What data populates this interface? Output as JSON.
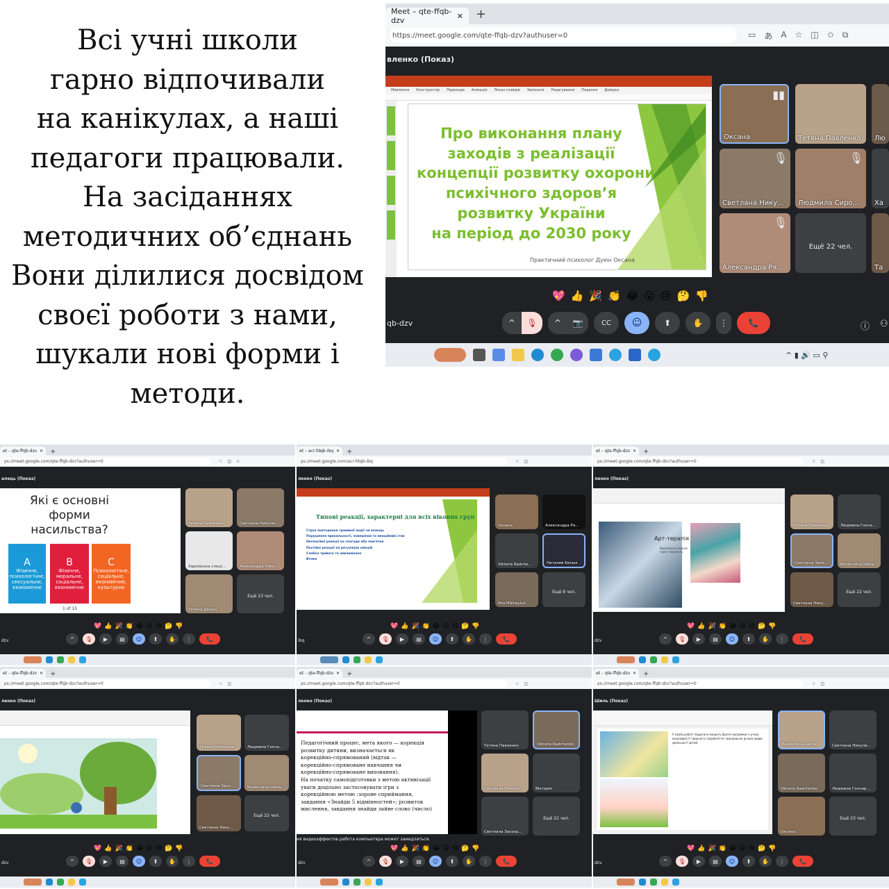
{
  "caption": {
    "lines": [
      "Всі учні школи",
      "гарно відпочивали",
      "на канікулах, а наші",
      "педагоги працювали.",
      "На засіданнях",
      "методичних об’єднань",
      "Вони ділилися досвідом",
      "своєї роботи з нами,",
      "шукали нові форми і",
      "методи."
    ]
  },
  "big": {
    "tab_title": "Meet – qte-ffqb-dzv",
    "new_tab": "+",
    "url": "https://meet.google.com/qte-ffqb-dzv?authuser=0",
    "presenter": "вленко (Показ)",
    "meeting_code": "qb-dzv",
    "ppt_menu": [
      "Мовлення",
      "Конструктор",
      "Переходи",
      "Анімація",
      "Показ слайдів",
      "Записати",
      "Редагування",
      "Подання",
      "Довідка"
    ],
    "slide_title": [
      "Про виконання плану",
      "заходів з реалізації",
      "концепції розвитку охорони",
      "психічного здоров’я",
      "розвитку України",
      "на період до 2030 року"
    ],
    "slide_author": "Практичний психолог Дуюн Оксана",
    "tiles": [
      "Оксана",
      "Тетяна Павленко",
      "Лю",
      "Светлана Нику...",
      "Людмила Сиро...",
      "Ха",
      "Александра Ря...",
      "Ещё 22 чел.",
      "Та"
    ],
    "reactions": [
      "💖",
      "👍",
      "🎉",
      "👏",
      "😂",
      "😮",
      "😢",
      "🤔",
      "👎"
    ]
  },
  "shots": [
    {
      "tab_title": "et – qte-ffqb-dzv",
      "url": "ps://meet.google.com/qte-ffqb-dzv?authuser=0",
      "presenter": "алець (Показ)",
      "code": "dzv",
      "slide_question": [
        "Які є основні",
        "форми",
        "насильства?"
      ],
      "boxes": [
        {
          "letter": "A",
          "text": "Фізичне, психологічне, сексуальне, економічне"
        },
        {
          "letter": "B",
          "text": "Фізичне, моральне, соціальне, економічне"
        },
        {
          "letter": "C",
          "text": "Психологічне, соціальне, економічне, культурне"
        }
      ],
      "pager": "1 of 15",
      "tiles": [
        "Тетяна Павленко",
        "Светлана Никули...",
        "Харківська спеці...",
        "Александра Рябк...",
        "Тетяна Дашко",
        "Ещё 23 чел."
      ]
    },
    {
      "tab_title": "et – acr-fdqb-ibq",
      "url": "ps://meet.google.com/acr-fdqb-ibq",
      "presenter": "ленко (Показ)",
      "code": "ibq",
      "slide_heading": "Типові реакції, характерні для всіх вікових груп",
      "bullets": [
        "Страх повторення травмної події чи вожаць",
        "Порушення прихильності, поведінки та емоційний стан",
        "Неспокійні реакції на спогади або пам'ятки",
        "Постійні реакції на регуляцію емоцій",
        "Слабка тривога та хвилювання",
        "Втома"
      ],
      "tiles": [
        "Оксана",
        "Александра Ря...",
        "Viktoria Radche...",
        "Наталия Белых",
        "Alla Mikhayluk",
        "Ещё 8 чел."
      ]
    },
    {
      "tab_title": "et – qte-ffqb-dzv",
      "url": "ps://meet.google.com/qte-ffqb-dzv?authuser=0",
      "presenter": "ленко (Показ)",
      "code": "dzv",
      "slide_heading": "Арт-терапія",
      "slide_note": "Вираження емоцій через творчість",
      "tiles": [
        "Тетяна Павленко",
        "Людмила Гонча...",
        "Светлана Засе...",
        "Валентина Шиль",
        "Светлана Нику...",
        "Ещё 22 чел."
      ]
    },
    {
      "tab_title": "et – qte-ffqb-dzv",
      "url": "ps://meet.google.com/qte-ffqb-dzv?authuser=0",
      "presenter": "ленко (Показ)",
      "code": "dzv",
      "tiles": [
        "Тетяна Павленко",
        "Людмила Гонча...",
        "Светлана Засе...",
        "Валентина Шиль",
        "Светлана Нику...",
        "Ещё 22 чел."
      ]
    },
    {
      "tab_title": "et – qte-ffqb-dzv",
      "url": "ps://meet.google.com/qte-ffqb-dzv?authuser=0",
      "presenter": "ленко (Показ)",
      "code": "dzv",
      "slide_text": [
        "Педагогічний процес, мета якого — корекція",
        "розвитку дитини, визначається як",
        "корекційно-спрямований (відтак —",
        "корекційно-спрямоване навчання чи",
        "корекційно-спрямоване виховання).",
        "На початку самопідготовки з метою активізації",
        "уваги доцільно застосовувати ігри з",
        "корекційною метою :зорове сприймання,",
        "завдання «Знайди 5 відмінностей»; розвиток",
        "мислення, завдання знайди зайве слово (число)"
      ],
      "warning": "ия видеоэффектов работа компьютера может замедлиться.",
      "tiles": [
        "Тетяна Павленко",
        "Viktoria Radchenko",
        "Светлана Никули...",
        "Вікторія",
        "Светлана Засоэр...",
        "Ещё 22 чел."
      ]
    },
    {
      "tab_title": "et – qte-ffqb-dzv",
      "url": "ps://meet.google.com/qte-ffqb-dzv?authuser=0",
      "presenter": "Шиль (Показ)",
      "code": "dzv",
      "slide_par": "У своїй роботі педагоги можуть брати напрямки з учнів, можливості творчого сприйняття і виховання різних видів діяльності дітей.",
      "tiles": [
        "Валентина Шиль",
        "Светлана Никули...",
        "Viktoria Radchenko",
        "Людмила Гончар...",
        "Оксана",
        "Ещё 23 чел."
      ]
    }
  ],
  "controls": [
    "^",
    "🎙",
    "^",
    "📷",
    "CC",
    "☺",
    "⬆",
    "✋",
    "⋮",
    "📞"
  ],
  "colors": {
    "green": "#7bbe2e",
    "meet_bg": "#202124",
    "tile_bg": "#3c4043",
    "end_red": "#ea4335",
    "ppt_orange": "#c43e1c"
  }
}
